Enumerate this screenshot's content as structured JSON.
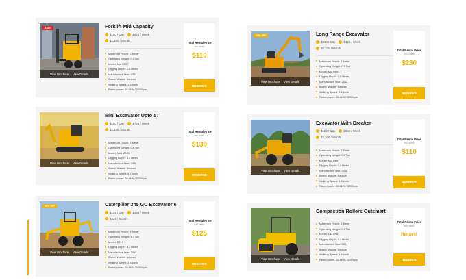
{
  "common": {
    "view_brochure": "View Brochure",
    "view_details": "View Details",
    "total_rental_price": "Total Rental Price",
    "incl_taxes": "Incl. taxes",
    "reserve": "RESERVE"
  },
  "cards": [
    {
      "title": "Forklift Mid Capacity",
      "badge": "SALE",
      "prices": [
        "$100 / Day",
        "$625 / Week",
        "$2,100 / Month"
      ],
      "specs": [
        "Maximum Reach: 2 Meter",
        "Operating Weight: 0.3 Ton",
        "Model: Mid DF87",
        "Digging Depth: 1.5 Meter",
        "Manufacture Year: 2012",
        "Brand: Wacker Neuson",
        "Walking Speed: 1.8 km/h",
        "Rated power: 26.8kW / 3200rpm"
      ],
      "price": "$110"
    },
    {
      "title": "Long Range Excavator",
      "badge": "15% OFF",
      "prices": [
        "$330 / Day",
        "$425 / Week",
        "$5,100 / Month"
      ],
      "specs": [
        "Maximum Reach: 2 Meter",
        "Operating Weight: 0.5 Ton",
        "Model: Mid DF87",
        "Digging Depth: 1.5 Meter",
        "Manufacture Year: 2012",
        "Brand: Wacker Neuson",
        "Walking Speed: 2.8 km/h",
        "Rated power: 26.8kW / 3200rpm"
      ],
      "price": "$230"
    },
    {
      "title": "Mini Excavator Upto 5T",
      "badge": "",
      "prices": [
        "$100 / Day",
        "$725 / Week",
        "$2,125 / Month"
      ],
      "specs": [
        "Maximum Reach: 2 Meter",
        "Operating Weight: 0.8 Ton",
        "Model: Mini M245",
        "Digging Depth: 3.3 Meter",
        "Manufacture Year: 2015",
        "Brand: Wacker Neuson",
        "Walking Speed: 3.7 km/h",
        "Rated power: 26.8kW / 3200rpm"
      ],
      "price": "$130"
    },
    {
      "title": "Excavator With Breaker",
      "badge": "",
      "prices": [
        "$100 / Day",
        "$625 / Week",
        "$2,100 / Month"
      ],
      "specs": [
        "Maximum Reach: 2 Meter",
        "Operating Weight: 0.5 Ton",
        "Model: Mid DF87",
        "Digging Depth: 1.5 Meter",
        "Manufacture Year: 2012",
        "Brand: Wacker Neuson",
        "Walking Speed: 1.8 km/h",
        "Rated power: 26.8kW / 3200rpm"
      ],
      "price": "$110"
    },
    {
      "title": "Caterpillar 345 GC Excavator 6",
      "badge": "20% OFF",
      "prices": [
        "$125 / Day",
        "$250 / Week",
        "$425 / Month"
      ],
      "specs": [
        "Maximum Reach: 4 Meter",
        "Operating Weight: 1.7 Ton",
        "Model: E217",
        "Digging Depth: 4.3 Meter",
        "Manufacture Year: 2019",
        "Brand: Wacker Neuson",
        "Walking Speed: 2.8 km/h",
        "Rated power: 26.8kW / 3200rpm"
      ],
      "price": "$125"
    },
    {
      "title": "Compaction Rollers Outsmart",
      "badge": "",
      "prices": [],
      "specs": [
        "Maximum Reach: 2 Meter",
        "Operating Weight: 0.5 Ton",
        "Model: Cid DF87",
        "Digging Depth: 3.3 Meter",
        "Manufacture Year: 2017",
        "Brand: Wacker Neuson",
        "Walking Speed: 1.8 km/h",
        "Rated power: 26.8kW / 3200rpm"
      ],
      "price": "Request"
    }
  ],
  "colors": {
    "accent": "#f0b400",
    "sale_badge": "#d9262b",
    "card_bg": "#f4f4f4"
  }
}
